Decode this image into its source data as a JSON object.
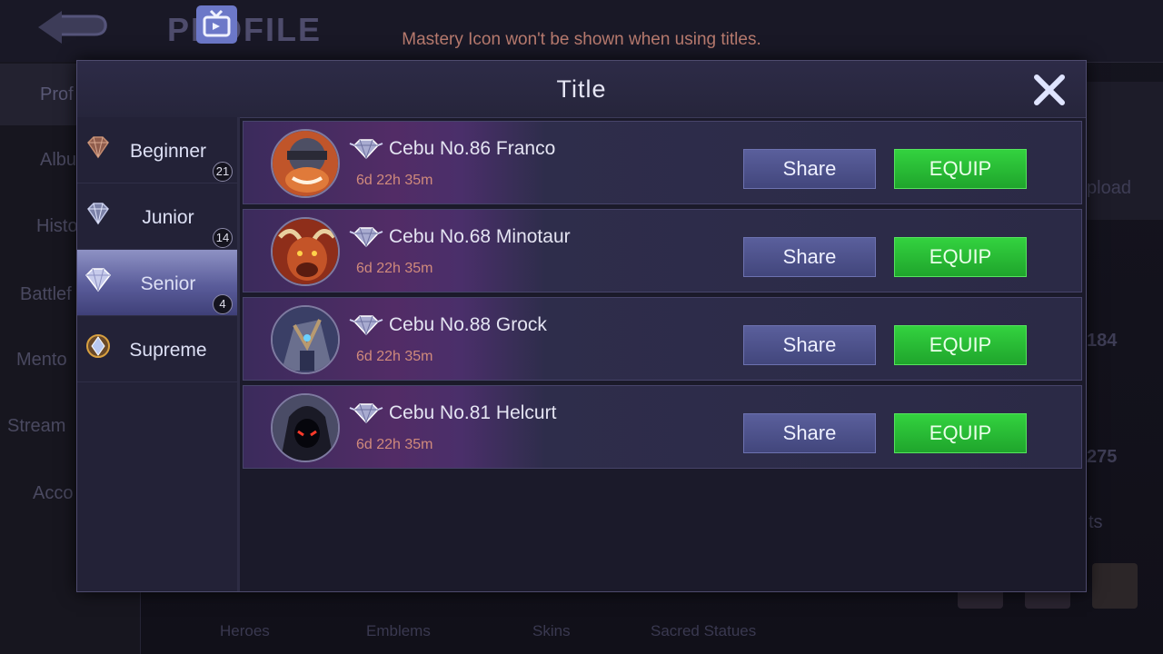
{
  "background": {
    "page_title": "PROFILE",
    "notice": "Mastery Icon won't be shown when using titles.",
    "nav": [
      "Prof",
      "Albu",
      "Histo",
      "Battlef",
      "Mento",
      "Stream",
      "Acco"
    ],
    "right_texts": [
      "pload",
      "184",
      "275",
      "ts"
    ],
    "bottom_tabs": [
      "Heroes",
      "Emblems",
      "Skins",
      "Sacred Statues"
    ]
  },
  "modal": {
    "title": "Title",
    "categories": [
      {
        "label": "Beginner",
        "badge": "21",
        "gem_color": "#b07860"
      },
      {
        "label": "Junior",
        "badge": "14",
        "gem_color": "#aab0d0"
      },
      {
        "label": "Senior",
        "badge": "4",
        "gem_color": "#e8eaff"
      },
      {
        "label": "Supreme",
        "badge": "",
        "gem_color": "#d8a040"
      }
    ],
    "selected_category": "Senior",
    "titles": [
      {
        "name": "Cebu No.86 Franco",
        "time": "6d 22h 35m",
        "share": "Share",
        "equip": "EQUIP"
      },
      {
        "name": "Cebu No.68 Minotaur",
        "time": "6d 22h 35m",
        "share": "Share",
        "equip": "EQUIP"
      },
      {
        "name": "Cebu No.88 Grock",
        "time": "6d 22h 35m",
        "share": "Share",
        "equip": "EQUIP"
      },
      {
        "name": "Cebu No.81 Helcurt",
        "time": "6d 22h 35m",
        "share": "Share",
        "equip": "EQUIP"
      }
    ]
  },
  "colors": {
    "equip_green": "#22b830",
    "share_blue": "#4c518a",
    "selected_tab": "#6e72ae",
    "timer": "#d08a7c"
  },
  "icons": [
    "back-arrow-icon",
    "tv-icon",
    "close-icon",
    "gem-icon",
    "hero-avatar"
  ]
}
